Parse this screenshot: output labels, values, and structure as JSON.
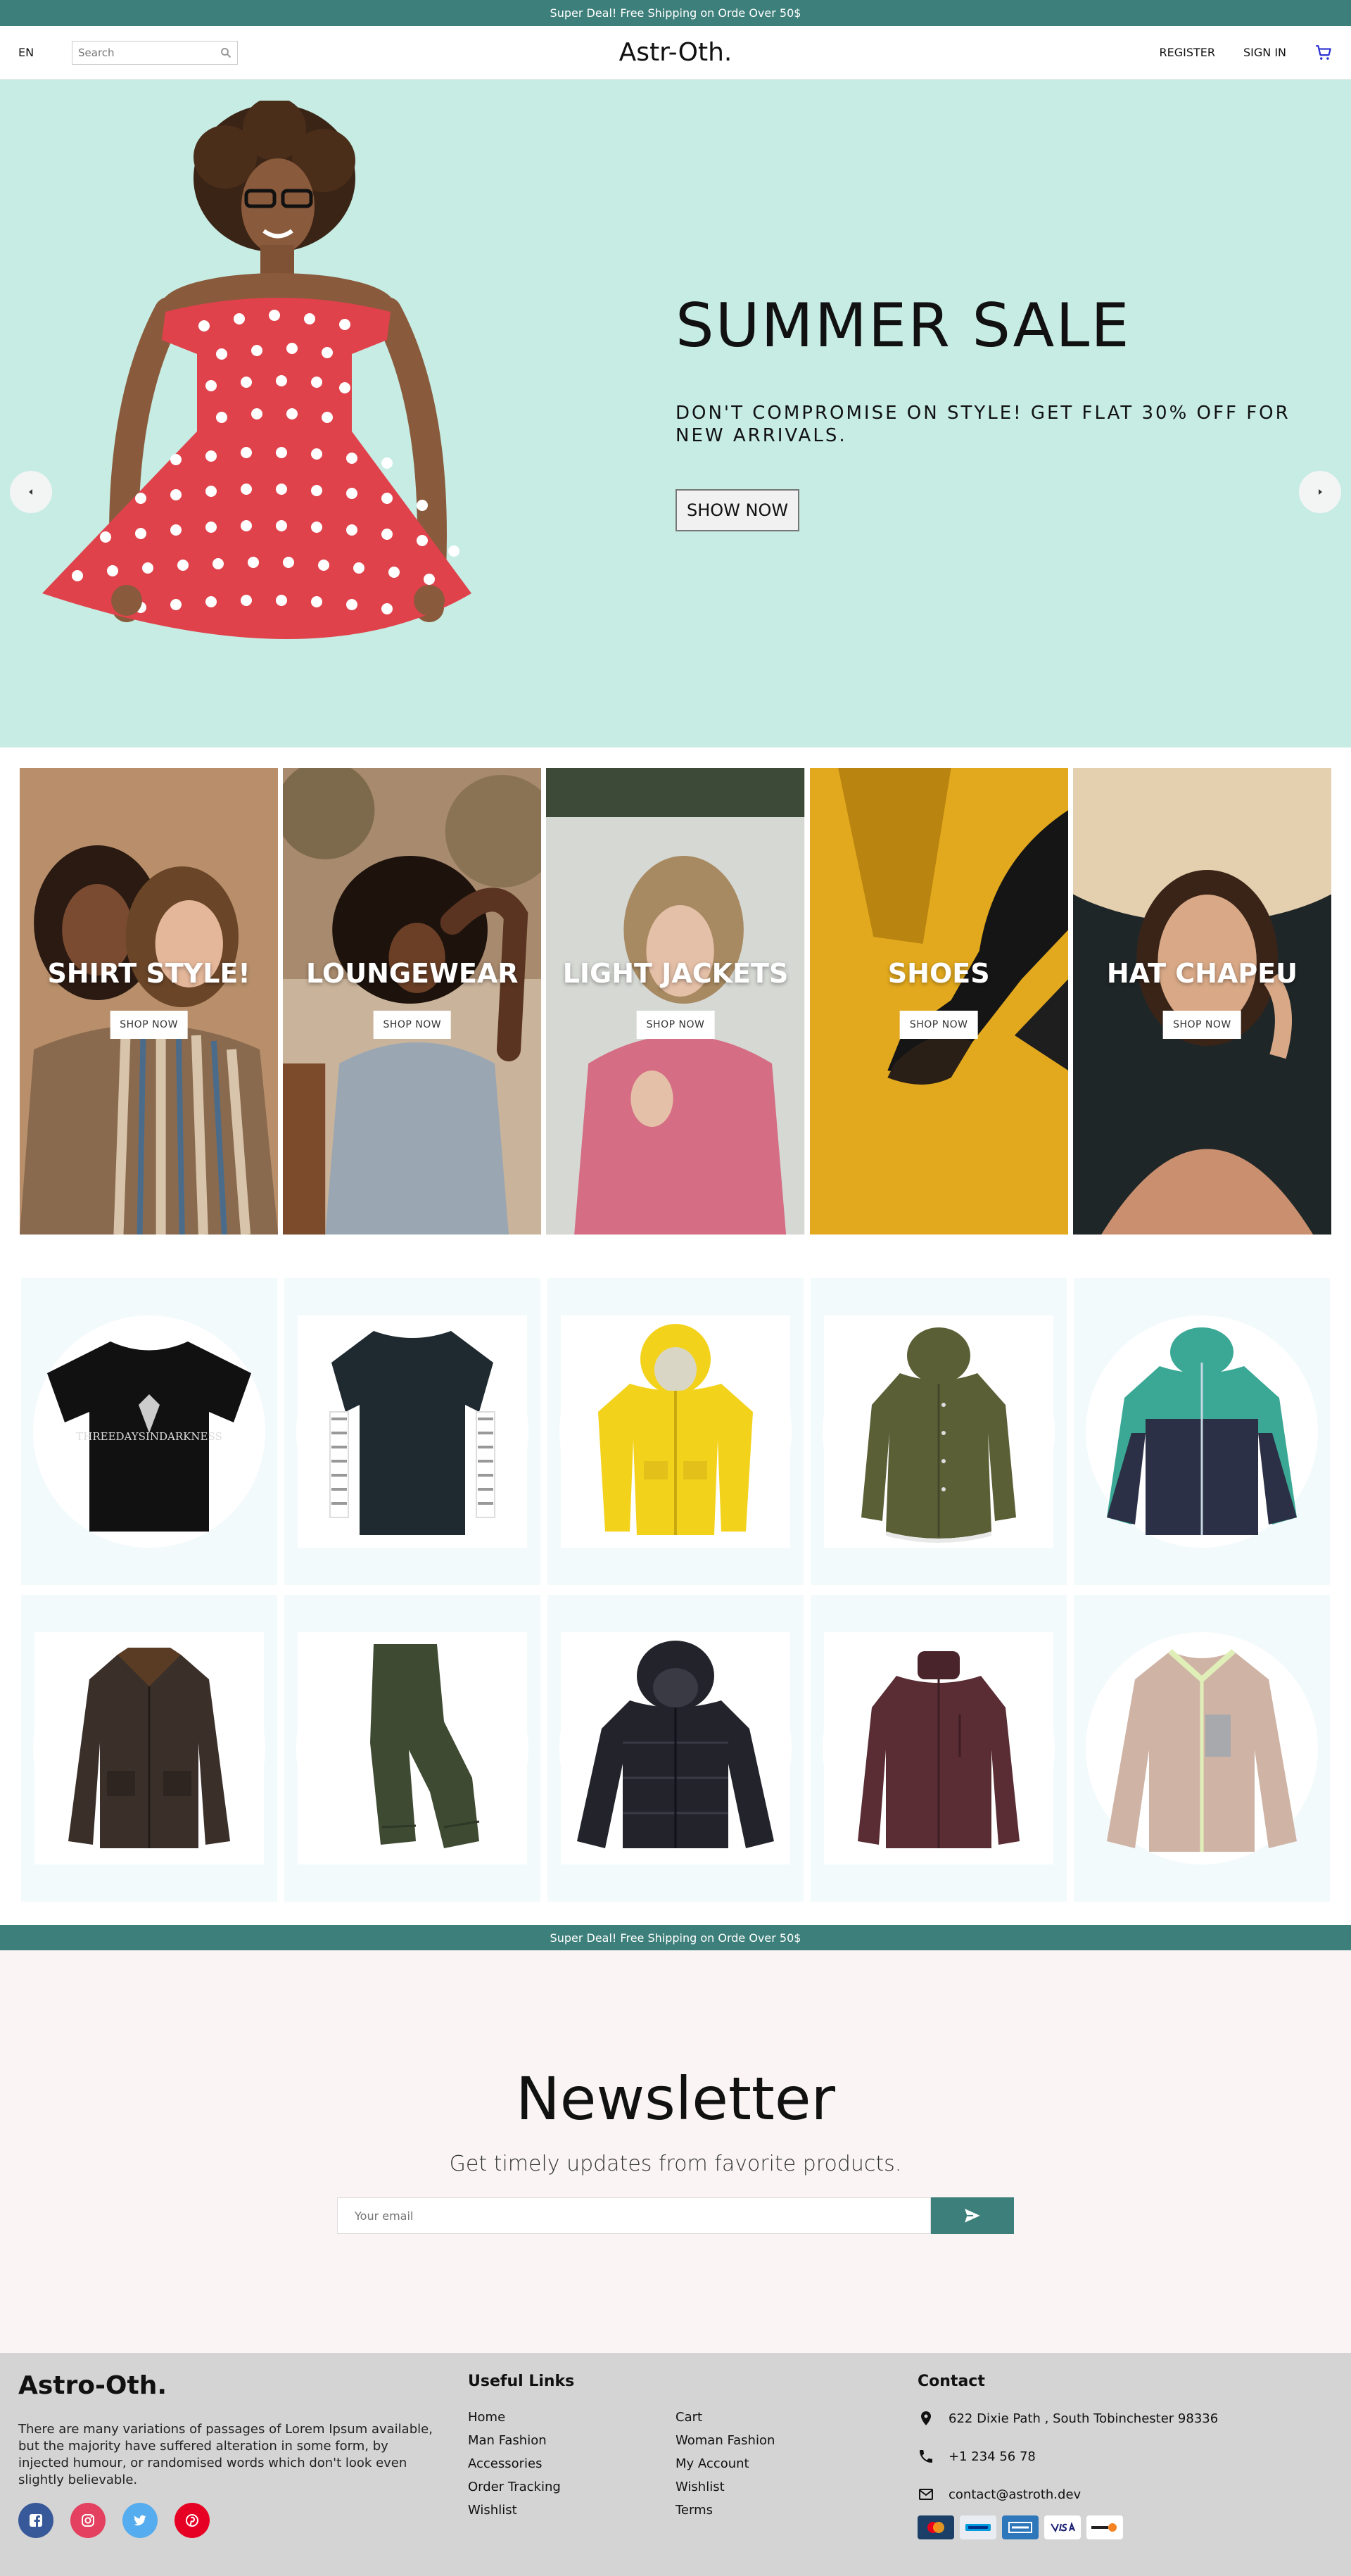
{
  "announcement": "Super Deal! Free Shipping on Orde Over 50$",
  "nav": {
    "language": "EN",
    "search_placeholder": "Search",
    "logo": "Astr-Oth.",
    "register": "REGISTER",
    "sign_in": "SIGN IN"
  },
  "hero": {
    "title": "SUMMER SALE",
    "description": "DON'T COMPROMISE ON STYLE! GET FLAT 30% OFF FOR NEW ARRIVALS.",
    "button": "SHOW NOW"
  },
  "categories": [
    {
      "title": "SHIRT STYLE!",
      "button": "SHOP NOW"
    },
    {
      "title": "LOUNGEWEAR",
      "button": "SHOP NOW"
    },
    {
      "title": "LIGHT JACKETS",
      "button": "SHOP NOW"
    },
    {
      "title": "SHOES",
      "button": "SHOP NOW"
    },
    {
      "title": "HAT CHAPEU",
      "button": "SHOP NOW"
    }
  ],
  "products": [
    {
      "name": "black-graphic-tshirt",
      "color": "#111111",
      "print": "THREEDAYSINDARKNESS"
    },
    {
      "name": "layered-longsleeve-tee",
      "color": "#1f2a30"
    },
    {
      "name": "yellow-rain-jacket",
      "color": "#f3d21c"
    },
    {
      "name": "olive-parka",
      "color": "#5b5f36"
    },
    {
      "name": "teal-navy-jacket",
      "color": "#3aa895"
    },
    {
      "name": "dark-waxed-jacket",
      "color": "#3a2f29"
    },
    {
      "name": "olive-pants",
      "color": "#3f4a33"
    },
    {
      "name": "black-puffer-jacket",
      "color": "#23232b"
    },
    {
      "name": "burgundy-shell-jacket",
      "color": "#5a2d35"
    },
    {
      "name": "fleece-jacket",
      "color": "#cfb4a6"
    }
  ],
  "newsletter": {
    "title": "Newsletter",
    "subtitle": "Get timely updates from favorite products.",
    "email_placeholder": "Your email"
  },
  "footer": {
    "brand": "Astro-Oth.",
    "about": "There are many variations of passages of Lorem Ipsum available, but the majority have suffered alteration in some form, by injected humour, or randomised words which don't look even slightly believable.",
    "useful_links_title": "Useful Links",
    "links": [
      "Home",
      "Cart",
      "Man Fashion",
      "Woman Fashion",
      "Accessories",
      "My Account",
      "Order Tracking",
      "Wishlist",
      "Wishlist",
      "Terms"
    ],
    "contact_title": "Contact",
    "address": "622 Dixie Path , South Tobinchester 98336",
    "phone": "+1 234 56 78",
    "email": "contact@astroth.dev",
    "payments": [
      "mastercard-icon",
      "paypal-icon",
      "amex-icon",
      "visa-icon",
      "discover-icon"
    ]
  },
  "colors": {
    "accent": "#3d7f7a",
    "hero_bg": "#c6ece4",
    "newsletter_bg": "#faf5f4",
    "footer_bg": "#d4d4d4"
  }
}
